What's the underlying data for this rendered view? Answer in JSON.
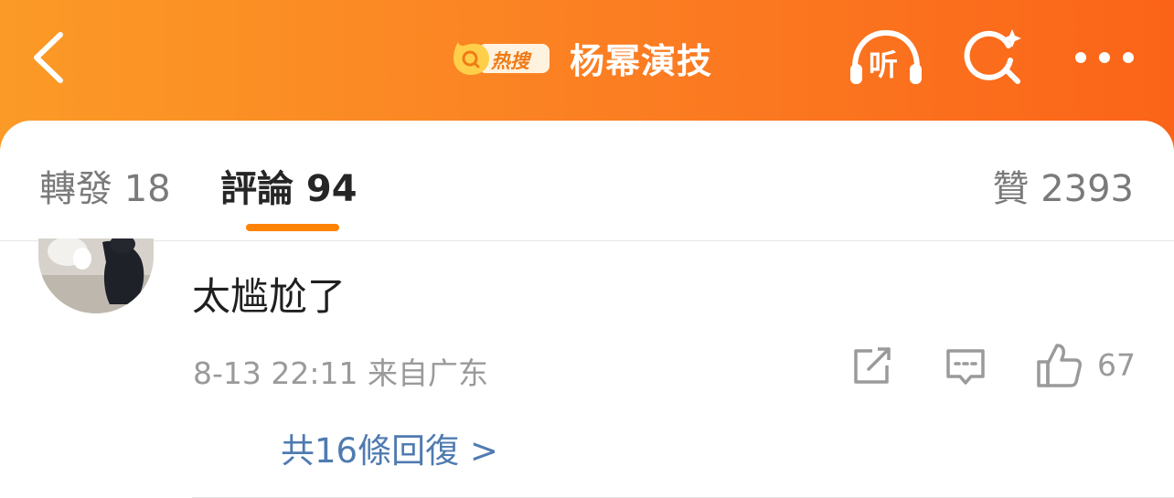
{
  "header": {
    "title": "杨幂演技",
    "hot_badge": "热搜",
    "back_icon": "chevron-left-icon",
    "listen_label": "听",
    "colors": {
      "gradient_start": "#fb9a26",
      "gradient_end": "#fb6418"
    }
  },
  "tabs": {
    "repost": "轉發 18",
    "comments": "評論 94",
    "likes": "贊 2393",
    "accent": "#ff8200"
  },
  "comment": {
    "text": "太尴尬了",
    "timestamp": "8-13 22:11 来自广东",
    "like_count": "67",
    "more_replies": "共16條回復 >"
  }
}
